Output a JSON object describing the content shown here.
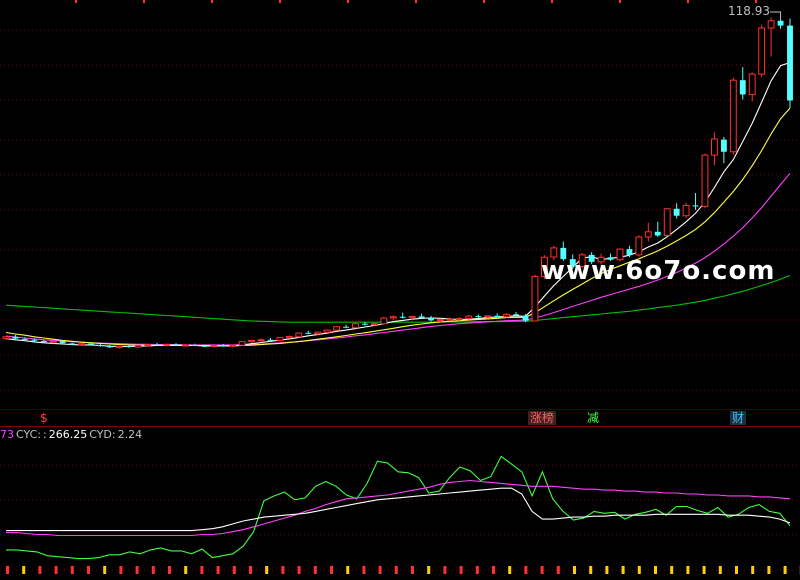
{
  "header": {
    "price_max": "118.93"
  },
  "watermark": "www.6o7o.com",
  "markers": {
    "a": "$",
    "b": "涨榜",
    "c": "减",
    "d": "财"
  },
  "indicator": {
    "cut_prefix": "73",
    "name": "CYC:",
    "sep": ":",
    "value": "266.25",
    "cyd_label": "CYD:",
    "cyd_value": "2.24"
  },
  "colors": {
    "up": "#ff3030",
    "down": "#54ffff",
    "ma_short": "#ffffff",
    "ma_mid": "#ffff40",
    "ma_long": "#ff40ff",
    "ma_longest": "#00c000",
    "ind_line": "#40ff40",
    "ind_pink": "#ff40ff",
    "ind_white": "#ffffff",
    "grid": "#7a0000"
  },
  "chart_data": [
    {
      "type": "candlestick",
      "ylim": [
        0,
        122
      ],
      "price_max_label": "118.93",
      "candles": [
        [
          13.0,
          13.9,
          12.5,
          13.6
        ],
        [
          13.6,
          14.2,
          12.8,
          13.0
        ],
        [
          12.9,
          13.4,
          12.2,
          12.7
        ],
        [
          12.6,
          13.1,
          12.0,
          12.3
        ],
        [
          12.2,
          12.6,
          11.6,
          11.8
        ],
        [
          11.9,
          12.3,
          11.4,
          12.1
        ],
        [
          12.1,
          12.5,
          11.2,
          11.5
        ],
        [
          11.4,
          11.8,
          10.8,
          11.0
        ],
        [
          11.0,
          11.6,
          10.6,
          11.3
        ],
        [
          11.3,
          11.7,
          10.7,
          10.9
        ],
        [
          10.9,
          11.3,
          10.3,
          10.5
        ],
        [
          10.5,
          10.9,
          9.9,
          10.1
        ],
        [
          10.0,
          10.6,
          9.7,
          10.4
        ],
        [
          10.5,
          11.0,
          10.0,
          10.2
        ],
        [
          10.2,
          10.9,
          9.9,
          10.7
        ],
        [
          10.7,
          11.2,
          10.4,
          11.0
        ],
        [
          11.0,
          11.6,
          10.5,
          10.8
        ],
        [
          10.8,
          11.3,
          10.4,
          11.1
        ],
        [
          11.1,
          11.5,
          10.6,
          10.8
        ],
        [
          10.7,
          11.2,
          10.3,
          10.9
        ],
        [
          10.9,
          11.3,
          10.5,
          10.6
        ],
        [
          10.6,
          11.0,
          10.2,
          10.4
        ],
        [
          10.4,
          10.9,
          10.1,
          10.7
        ],
        [
          10.7,
          11.2,
          10.3,
          10.5
        ],
        [
          10.5,
          10.9,
          10.1,
          10.8
        ],
        [
          10.8,
          12.2,
          10.6,
          12.0
        ],
        [
          12.0,
          12.6,
          11.6,
          12.4
        ],
        [
          12.4,
          13.0,
          12.0,
          12.6
        ],
        [
          12.6,
          13.2,
          12.1,
          12.4
        ],
        [
          12.4,
          13.5,
          12.2,
          13.3
        ],
        [
          13.3,
          14.0,
          12.9,
          13.7
        ],
        [
          13.6,
          15.0,
          13.3,
          14.8
        ],
        [
          14.9,
          15.6,
          14.4,
          14.6
        ],
        [
          14.6,
          15.3,
          14.1,
          15.1
        ],
        [
          15.1,
          16.0,
          14.8,
          15.8
        ],
        [
          15.8,
          17.2,
          15.5,
          16.9
        ],
        [
          16.9,
          17.6,
          16.4,
          16.6
        ],
        [
          16.6,
          18.2,
          16.4,
          17.9
        ],
        [
          17.9,
          18.5,
          17.3,
          17.6
        ],
        [
          17.6,
          18.3,
          17.1,
          17.9
        ],
        [
          17.9,
          20.2,
          17.6,
          19.8
        ],
        [
          19.8,
          20.6,
          19.2,
          20.2
        ],
        [
          20.2,
          21.5,
          19.6,
          19.9
        ],
        [
          19.9,
          20.6,
          19.0,
          20.3
        ],
        [
          20.3,
          21.2,
          19.6,
          19.8
        ],
        [
          19.8,
          20.5,
          18.6,
          19.0
        ],
        [
          19.0,
          19.6,
          18.2,
          19.3
        ],
        [
          19.3,
          20.0,
          18.7,
          19.4
        ],
        [
          19.4,
          20.1,
          18.8,
          19.6
        ],
        [
          19.6,
          20.8,
          19.2,
          20.4
        ],
        [
          20.4,
          21.0,
          19.8,
          20.1
        ],
        [
          20.1,
          20.7,
          19.6,
          20.5
        ],
        [
          20.5,
          21.3,
          20.0,
          20.2
        ],
        [
          20.2,
          21.4,
          19.9,
          21.0
        ],
        [
          21.0,
          21.8,
          20.3,
          20.6
        ],
        [
          20.6,
          21.1,
          18.4,
          18.9
        ],
        [
          18.8,
          34.0,
          18.8,
          33.5
        ],
        [
          33.5,
          40.5,
          32.6,
          39.8
        ],
        [
          39.9,
          43.6,
          38.9,
          42.9
        ],
        [
          42.9,
          45.0,
          38.6,
          39.2
        ],
        [
          39.2,
          40.8,
          36.0,
          36.8
        ],
        [
          36.8,
          41.2,
          36.2,
          40.6
        ],
        [
          40.6,
          41.5,
          37.6,
          38.3
        ],
        [
          38.3,
          41.0,
          37.4,
          39.8
        ],
        [
          39.8,
          41.0,
          38.6,
          39.0
        ],
        [
          39.0,
          42.8,
          38.5,
          42.5
        ],
        [
          42.5,
          43.6,
          39.8,
          40.6
        ],
        [
          40.6,
          47.0,
          40.0,
          46.5
        ],
        [
          46.5,
          51.2,
          45.0,
          48.2
        ],
        [
          48.2,
          51.5,
          46.5,
          47.0
        ],
        [
          47.0,
          56.0,
          46.8,
          55.8
        ],
        [
          55.8,
          57.6,
          52.6,
          53.5
        ],
        [
          53.5,
          57.8,
          52.8,
          56.9
        ],
        [
          56.9,
          61.0,
          55.4,
          56.6
        ],
        [
          56.6,
          74.0,
          56.0,
          73.5
        ],
        [
          73.5,
          81.0,
          70.2,
          78.8
        ],
        [
          78.6,
          79.5,
          70.8,
          74.6
        ],
        [
          74.6,
          99.0,
          73.6,
          98.2
        ],
        [
          98.2,
          102.5,
          91.8,
          93.5
        ],
        [
          93.5,
          100.8,
          91.2,
          100.2
        ],
        [
          100.2,
          116.6,
          99.2,
          115.4
        ],
        [
          115.4,
          118.93,
          106.0,
          117.8
        ],
        [
          117.8,
          118.6,
          115.2,
          116.2
        ],
        [
          116.2,
          118.5,
          89.0,
          91.5
        ]
      ],
      "ma_short": [
        13.0,
        12.6,
        12.3,
        11.9,
        11.6,
        11.4,
        11.2,
        11.0,
        10.9,
        10.9,
        10.7,
        10.5,
        10.4,
        10.4,
        10.5,
        10.6,
        10.7,
        10.8,
        10.8,
        10.8,
        10.7,
        10.6,
        10.6,
        10.6,
        10.6,
        10.9,
        11.3,
        11.7,
        12.1,
        12.5,
        12.9,
        13.4,
        13.9,
        14.3,
        14.8,
        15.4,
        15.8,
        16.3,
        16.8,
        17.3,
        17.9,
        18.6,
        19.0,
        19.4,
        19.7,
        19.8,
        19.7,
        19.5,
        19.3,
        19.4,
        19.6,
        19.9,
        20.1,
        20.3,
        20.5,
        20.3,
        23.5,
        27.0,
        30.5,
        33.5,
        36.5,
        39.5,
        40.0,
        39.0,
        39.5,
        39.8,
        40.5,
        41.6,
        43.2,
        44.5,
        46.6,
        49.0,
        51.5,
        54.3,
        58.0,
        62.8,
        68.0,
        72.0,
        78.0,
        84.0,
        91.0,
        98.0,
        103.0,
        104.0
      ],
      "ma_mid": [
        15.0,
        14.5,
        14.1,
        13.6,
        13.2,
        12.8,
        12.4,
        12.1,
        11.8,
        11.6,
        11.4,
        11.2,
        11.0,
        10.9,
        10.8,
        10.8,
        10.7,
        10.7,
        10.7,
        10.7,
        10.7,
        10.7,
        10.6,
        10.6,
        10.6,
        10.7,
        10.8,
        11.0,
        11.2,
        11.4,
        11.7,
        12.0,
        12.4,
        12.8,
        13.2,
        13.6,
        14.0,
        14.5,
        14.9,
        15.4,
        15.9,
        16.4,
        16.9,
        17.4,
        17.8,
        18.2,
        18.5,
        18.7,
        18.9,
        19.1,
        19.3,
        19.5,
        19.7,
        19.9,
        20.0,
        20.0,
        21.5,
        23.5,
        25.5,
        27.4,
        29.2,
        31.0,
        32.8,
        34.4,
        35.8,
        37.0,
        38.2,
        39.3,
        40.6,
        41.9,
        43.5,
        45.2,
        47.0,
        49.0,
        51.5,
        54.5,
        58.0,
        61.5,
        65.5,
        70.0,
        75.0,
        80.5,
        85.5,
        89.0
      ],
      "ma_long": [
        13.8,
        13.5,
        13.2,
        12.9,
        12.6,
        12.4,
        12.2,
        12.0,
        11.8,
        11.6,
        11.5,
        11.4,
        11.3,
        11.2,
        11.1,
        11.1,
        11.0,
        11.0,
        11.0,
        10.9,
        10.9,
        10.9,
        10.9,
        10.9,
        10.9,
        11.0,
        11.1,
        11.2,
        11.4,
        11.6,
        11.8,
        12.0,
        12.3,
        12.6,
        12.9,
        13.2,
        13.5,
        13.9,
        14.2,
        14.6,
        15.0,
        15.4,
        15.8,
        16.2,
        16.6,
        17.0,
        17.3,
        17.6,
        17.9,
        18.1,
        18.3,
        18.5,
        18.7,
        18.9,
        19.0,
        19.1,
        19.8,
        20.6,
        21.6,
        22.6,
        23.6,
        24.6,
        25.6,
        26.6,
        27.5,
        28.4,
        29.3,
        30.2,
        31.2,
        32.3,
        33.5,
        34.8,
        36.3,
        37.9,
        39.7,
        41.8,
        44.2,
        46.8,
        49.6,
        52.8,
        56.2,
        60.0,
        63.8,
        67.5
      ],
      "ma_longest": [
        24.0,
        23.8,
        23.6,
        23.4,
        23.2,
        23.0,
        22.8,
        22.6,
        22.4,
        22.2,
        22.0,
        21.8,
        21.6,
        21.4,
        21.2,
        21.0,
        20.8,
        20.6,
        20.4,
        20.2,
        20.0,
        19.8,
        19.6,
        19.4,
        19.2,
        19.0,
        18.8,
        18.7,
        18.6,
        18.5,
        18.4,
        18.4,
        18.4,
        18.4,
        18.4,
        18.4,
        18.4,
        18.4,
        18.4,
        18.4,
        18.4,
        18.4,
        18.4,
        18.4,
        18.4,
        18.4,
        18.5,
        18.5,
        18.5,
        18.5,
        18.6,
        18.6,
        18.6,
        18.6,
        18.7,
        18.7,
        19.0,
        19.3,
        19.6,
        19.9,
        20.2,
        20.5,
        20.8,
        21.1,
        21.4,
        21.7,
        22.0,
        22.4,
        22.8,
        23.2,
        23.6,
        24.0,
        24.5,
        25.0,
        25.6,
        26.3,
        27.0,
        27.8,
        28.6,
        29.5,
        30.5,
        31.5,
        32.6,
        33.8
      ]
    },
    {
      "type": "line",
      "name": "CYC",
      "value_label": "266.25",
      "cyd_value": "2.24",
      "ylim": [
        0,
        140
      ],
      "series": [
        {
          "key": "ind_line",
          "values": [
            26,
            26,
            25,
            24,
            20,
            19,
            18,
            17,
            17,
            18,
            21,
            21,
            24,
            22,
            26,
            28,
            25,
            25,
            22,
            27,
            18,
            20,
            22,
            30,
            45,
            77,
            82,
            86,
            78,
            80,
            92,
            97,
            92,
            83,
            79,
            95,
            118,
            116,
            107,
            106,
            101,
            85,
            87,
            101,
            112,
            108,
            98,
            102,
            123,
            115,
            107,
            82,
            107,
            79,
            66,
            57,
            59,
            66,
            64,
            65,
            58,
            63,
            65,
            68,
            62,
            71,
            71,
            67,
            64,
            70,
            60,
            63,
            70,
            73,
            66,
            64,
            51
          ]
        },
        {
          "key": "ind_pink",
          "values": [
            44,
            44,
            43,
            42,
            42,
            41,
            41,
            41,
            41,
            41,
            41,
            41,
            41,
            41,
            41,
            41,
            41,
            41,
            41,
            42,
            42,
            43,
            45,
            47,
            50,
            53,
            56,
            59,
            62,
            66,
            69,
            73,
            76,
            79,
            80,
            81,
            82,
            83,
            85,
            87,
            89,
            91,
            94,
            96,
            97,
            98,
            97,
            96,
            95,
            94,
            93,
            92,
            92,
            92,
            91,
            90,
            89,
            89,
            88,
            88,
            87,
            87,
            86,
            86,
            85,
            85,
            84,
            84,
            83,
            83,
            82,
            82,
            82,
            81,
            81,
            80,
            79
          ]
        },
        {
          "key": "ind_white",
          "values": [
            46,
            46,
            46,
            46,
            46,
            46,
            46,
            46,
            46,
            46,
            46,
            46,
            46,
            46,
            46,
            46,
            46,
            46,
            46,
            47,
            48,
            50,
            53,
            56,
            58,
            60,
            61,
            62,
            63,
            64,
            66,
            68,
            70,
            72,
            74,
            76,
            78,
            79,
            80,
            81,
            82,
            83,
            84,
            85,
            86,
            87,
            88,
            89,
            90,
            90,
            84,
            66,
            58,
            58,
            59,
            60,
            60,
            61,
            61,
            62,
            62,
            62,
            62,
            63,
            63,
            63,
            63,
            63,
            63,
            63,
            62,
            62,
            62,
            61,
            60,
            58,
            54
          ]
        }
      ]
    }
  ]
}
